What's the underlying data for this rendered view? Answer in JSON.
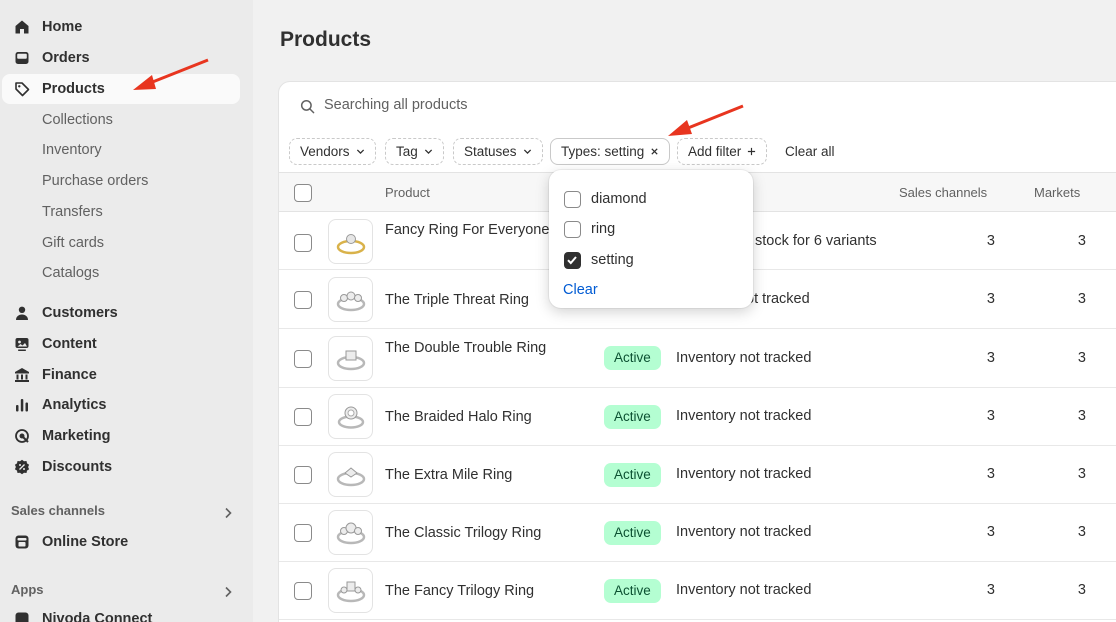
{
  "sidebar": {
    "home": "Home",
    "orders": "Orders",
    "products": "Products",
    "sub": [
      "Collections",
      "Inventory",
      "Purchase orders",
      "Transfers",
      "Gift cards",
      "Catalogs"
    ],
    "customers": "Customers",
    "content": "Content",
    "finance": "Finance",
    "analytics": "Analytics",
    "marketing": "Marketing",
    "discounts": "Discounts",
    "sales_channels_title": "Sales channels",
    "online_store": "Online Store",
    "apps_title": "Apps",
    "app_item": "Nivoda Connect"
  },
  "page": {
    "title": "Products"
  },
  "search": {
    "placeholder": "Searching all products"
  },
  "filters": {
    "vendors": "Vendors",
    "tag": "Tag",
    "statuses": "Statuses",
    "types": "Types: setting",
    "add_filter": "Add filter",
    "clear_all": "Clear all"
  },
  "table": {
    "headers": {
      "product": "Product",
      "sales_channels": "Sales channels",
      "markets": "Markets"
    },
    "rows": [
      {
        "name": "Fancy Ring For Everyone",
        "status": "",
        "inventory": "stock for 6 variants",
        "sales_channels": "3",
        "markets": "3"
      },
      {
        "name": "The Triple Threat Ring",
        "status": "",
        "inventory": "ot tracked",
        "sales_channels": "3",
        "markets": "3"
      },
      {
        "name": "The Double Trouble Ring",
        "status": "Active",
        "inventory": "Inventory not tracked",
        "sales_channels": "3",
        "markets": "3"
      },
      {
        "name": "The Braided Halo Ring",
        "status": "Active",
        "inventory": "Inventory not tracked",
        "sales_channels": "3",
        "markets": "3"
      },
      {
        "name": "The Extra Mile Ring",
        "status": "Active",
        "inventory": "Inventory not tracked",
        "sales_channels": "3",
        "markets": "3"
      },
      {
        "name": "The Classic Trilogy Ring",
        "status": "Active",
        "inventory": "Inventory not tracked",
        "sales_channels": "3",
        "markets": "3"
      },
      {
        "name": "The Fancy Trilogy Ring",
        "status": "Active",
        "inventory": "Inventory not tracked",
        "sales_channels": "3",
        "markets": "3"
      }
    ]
  },
  "type_popover": {
    "options": [
      {
        "label": "diamond",
        "checked": false
      },
      {
        "label": "ring",
        "checked": false
      },
      {
        "label": "setting",
        "checked": true
      }
    ],
    "clear": "Clear"
  },
  "colors": {
    "badge_bg": "#b4fed2",
    "badge_text": "#0c5132",
    "link": "#005bd3",
    "arrow": "#e8351f"
  }
}
